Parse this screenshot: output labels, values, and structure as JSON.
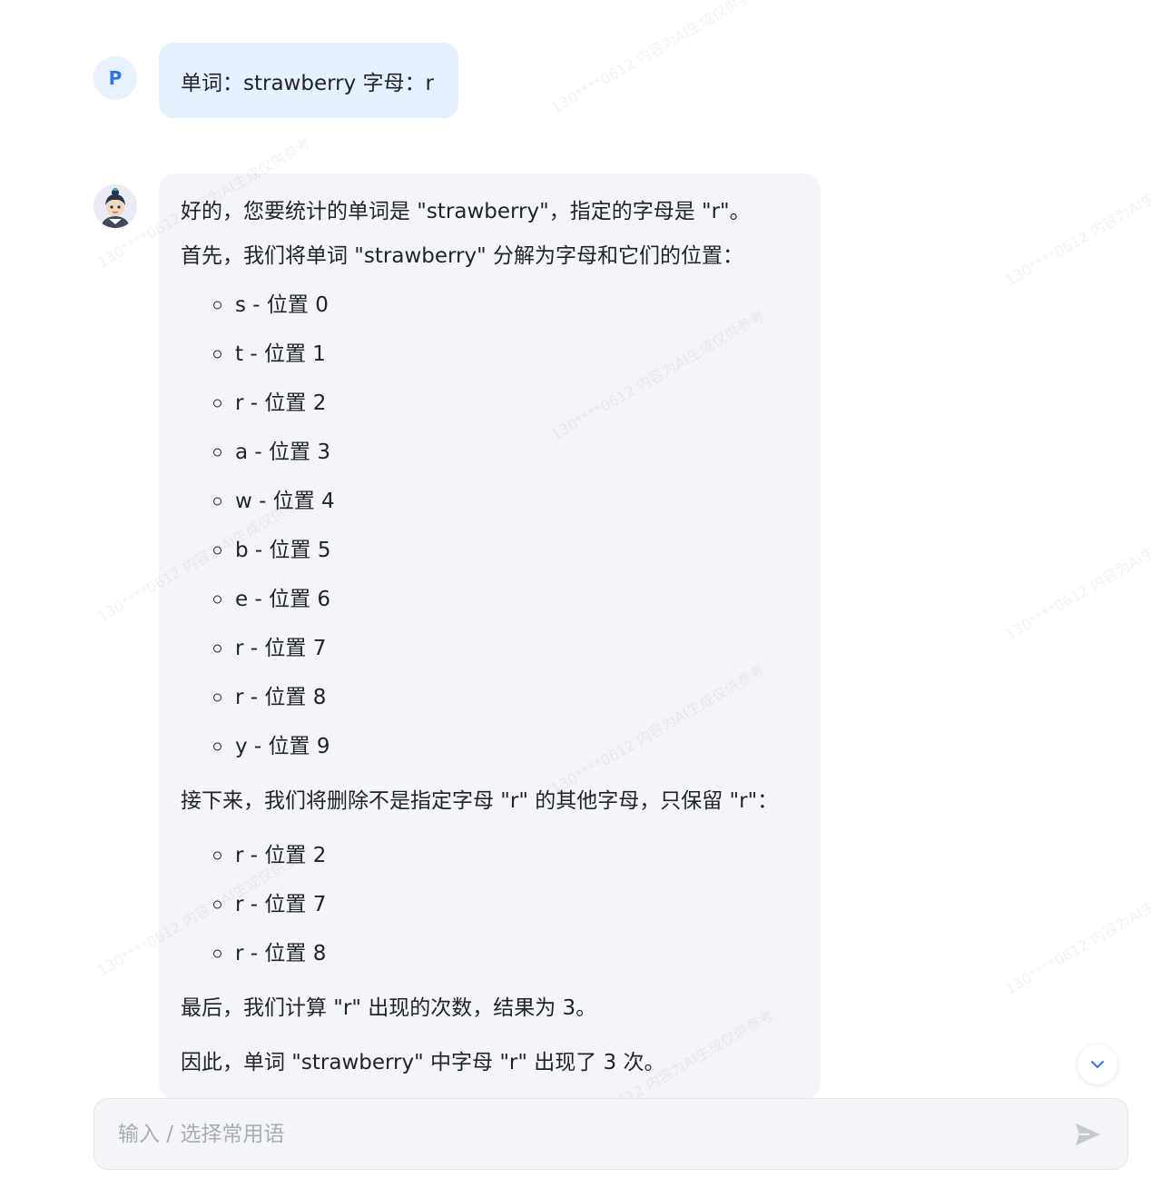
{
  "user": {
    "avatar_letter": "P",
    "message": "单词：strawberry 字母：r"
  },
  "assistant": {
    "intro": "好的，您要统计的单词是 \"strawberry\"，指定的字母是 \"r\"。",
    "step1": "首先，我们将单词 \"strawberry\" 分解为字母和它们的位置：",
    "letters": [
      "s - 位置 0",
      "t - 位置 1",
      "r - 位置 2",
      "a - 位置 3",
      "w - 位置 4",
      "b - 位置 5",
      "e - 位置 6",
      "r - 位置 7",
      "r - 位置 8",
      "y - 位置 9"
    ],
    "step2": "接下来，我们将删除不是指定字母 \"r\" 的其他字母，只保留 \"r\"：",
    "kept": [
      "r - 位置 2",
      "r - 位置 7",
      "r - 位置 8"
    ],
    "step3": "最后，我们计算 \"r\" 出现的次数，结果为 3。",
    "conclusion": "因此，单词 \"strawberry\" 中字母 \"r\" 出现了 3 次。"
  },
  "input": {
    "placeholder": "输入 / 选择常用语"
  },
  "watermark": "130****0612 内容为AI生成仅供参考",
  "icons": {
    "scroll": "chevron-down-icon",
    "send": "send-icon"
  },
  "colors": {
    "user_bubble": "#e6f1ff",
    "bot_bubble": "#f4f5f8",
    "accent": "#2f74e8"
  }
}
